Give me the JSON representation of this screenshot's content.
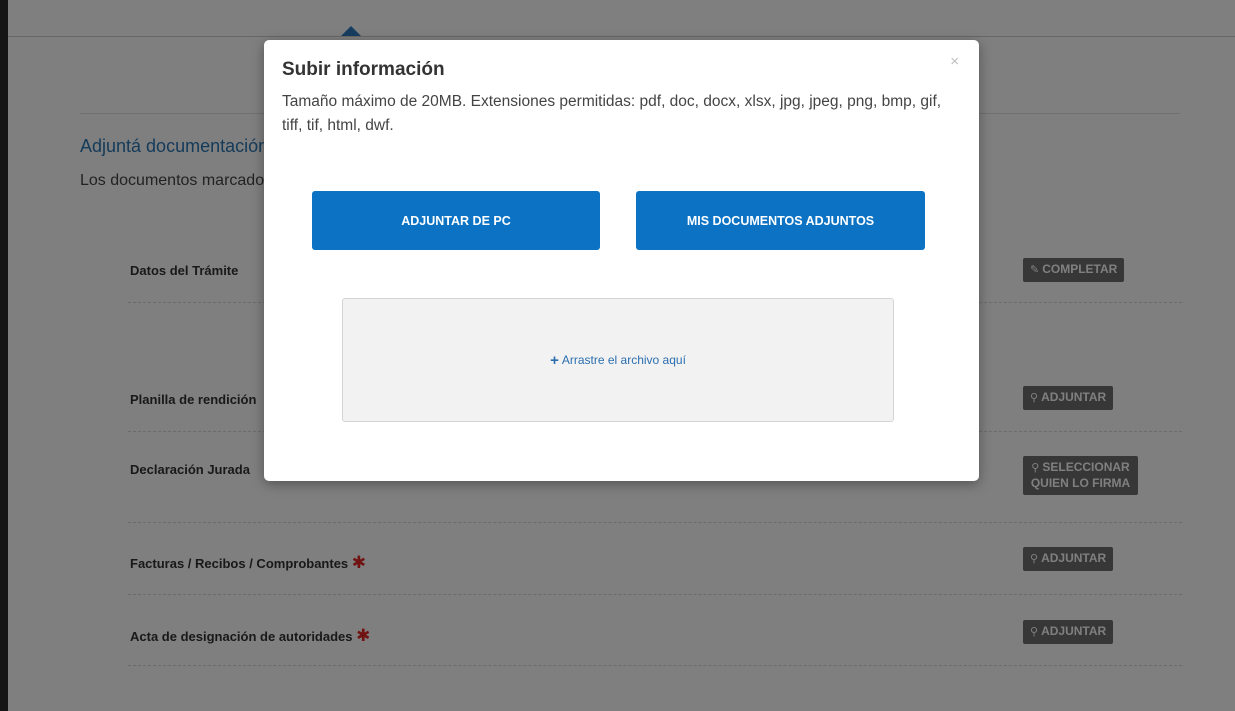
{
  "section": {
    "title": "Adjuntá documentación",
    "description": "Los documentos marcados con asterisco son obligatorios"
  },
  "documents": [
    {
      "label": "Datos del Trámite",
      "required": false,
      "action_icon": "pencil-icon",
      "action_glyph": "✎",
      "action_label": "COMPLETAR"
    },
    {
      "label": "Planilla de rendición",
      "required": false,
      "action_icon": "paperclip-icon",
      "action_glyph": "⚲",
      "action_label": "ADJUNTAR"
    },
    {
      "label": "Declaración Jurada",
      "required": false,
      "action_icon": "search-icon",
      "action_glyph": "⚲",
      "action_label_line1": "SELECCIONAR",
      "action_label_line2": "QUIEN LO FIRMA"
    },
    {
      "label": "Facturas / Recibos / Comprobantes",
      "required": true,
      "action_icon": "paperclip-icon",
      "action_glyph": "⚲",
      "action_label": "ADJUNTAR"
    },
    {
      "label": "Acta de designación de autoridades",
      "required": true,
      "action_icon": "paperclip-icon",
      "action_glyph": "⚲",
      "action_label": "ADJUNTAR"
    }
  ],
  "required_marker": "✱",
  "modal": {
    "title": "Subir información",
    "close_glyph": "×",
    "description": "Tamaño máximo de 20MB. Extensiones permitidas: pdf, doc, docx, xlsx, jpg, jpeg, png, bmp, gif, tiff, tif, html, dwf.",
    "attach_pc_label": "ADJUNTAR DE PC",
    "my_documents_label": "MIS DOCUMENTOS ADJUNTOS",
    "dropzone_plus": "+",
    "dropzone_label": "Arrastre el archivo aquí"
  },
  "colors": {
    "primary": "#0b72c4",
    "section_title": "#2b77b4",
    "required": "#e02424",
    "action_button": "#6e6e6e"
  }
}
